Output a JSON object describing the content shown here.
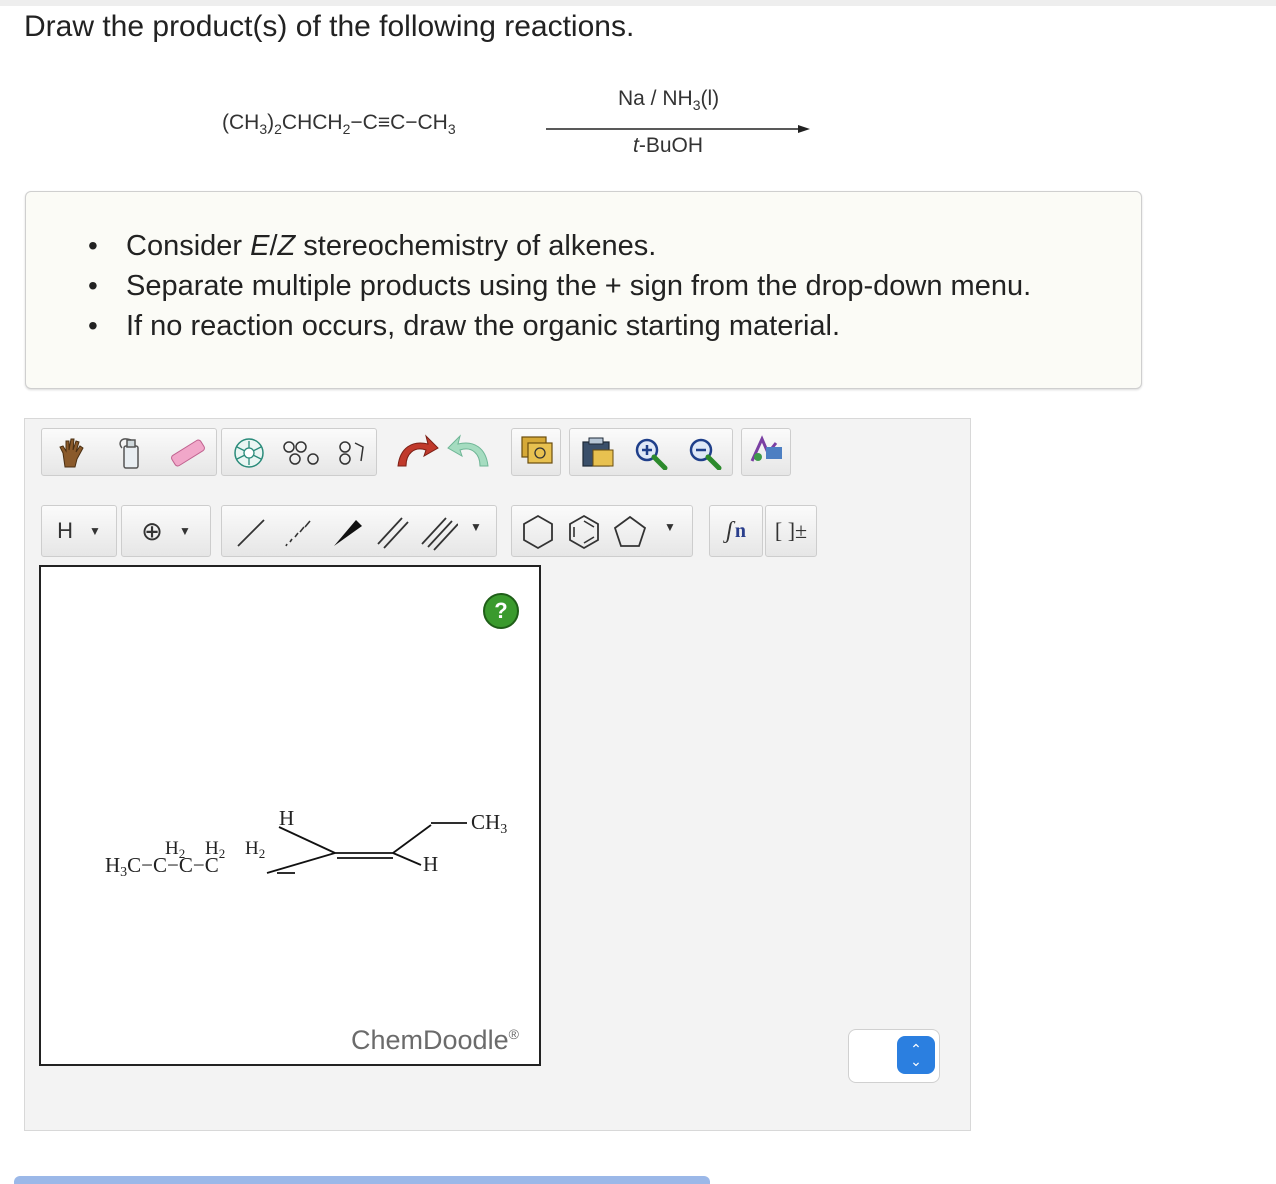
{
  "question": "Draw the product(s) of the following reactions.",
  "reaction": {
    "reactant_parts": [
      "(CH",
      "3",
      ")",
      "2",
      "CHCH",
      "2",
      "−C≡C−CH",
      "3"
    ],
    "reagent_top_parts": [
      "Na / NH",
      "3",
      "(l)"
    ],
    "reagent_bottom_prefix": "t",
    "reagent_bottom_suffix": "-BuOH"
  },
  "instructions": {
    "item1_pre": "Consider ",
    "item1_em": "E",
    "item1_slash": "/",
    "item1_em2": "Z",
    "item1_post": " stereochemistry of alkenes.",
    "item2": "Separate multiple products using the + sign from the drop-down menu.",
    "item3": "If no reaction occurs, draw the organic starting material."
  },
  "toolbar": {
    "hydrogen_label": "H",
    "charge_label": "⊕",
    "sgroup_label": "n",
    "bracket_label": "[ ]±"
  },
  "canvas": {
    "help_label": "?",
    "watermark": "ChemDoodle",
    "watermark_mark": "®"
  },
  "molecule": {
    "left_group": "H3C−C−C−C",
    "h2_labels": [
      "H2",
      "H2",
      "H2"
    ],
    "atom_h_top": "H",
    "atom_h_bottom": "H",
    "atom_ch3": "CH3"
  },
  "colors": {
    "accent_blue": "#2b7fe0",
    "help_green": "#3a9a2d"
  }
}
